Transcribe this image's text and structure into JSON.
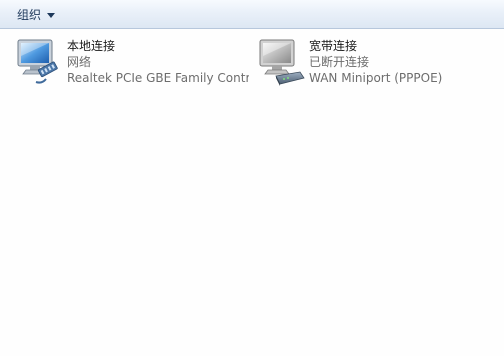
{
  "toolbar": {
    "organize_label": "组织"
  },
  "connections": [
    {
      "name": "本地连接",
      "status": "网络",
      "device": "Realtek PCIe GBE Family Contr...",
      "icon": "ethernet-adapter-icon"
    },
    {
      "name": "宽带连接",
      "status": "已断开连接",
      "device": "WAN Miniport (PPPOE)",
      "icon": "broadband-modem-icon"
    }
  ],
  "colors": {
    "toolbar_text": "#1e395b",
    "secondary_text": "#6d6d6d",
    "background": "#fefefe"
  }
}
